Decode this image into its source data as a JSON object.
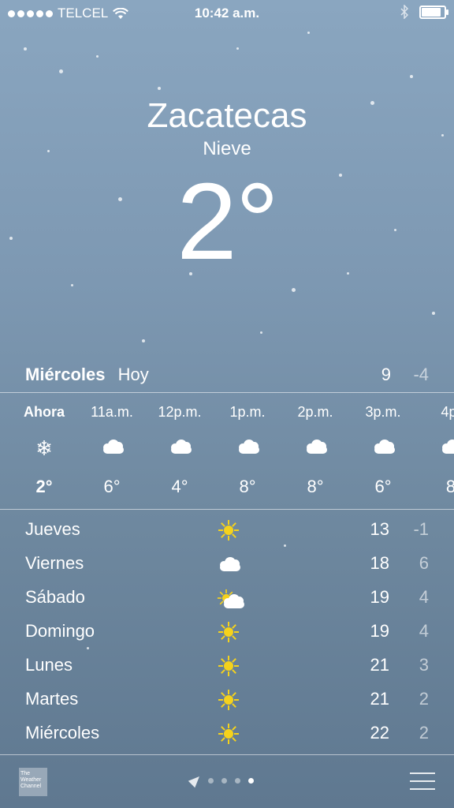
{
  "status_bar": {
    "carrier": "TELCEL",
    "time": "10:42 a.m."
  },
  "location": {
    "city": "Zacatecas",
    "condition": "Nieve",
    "temperature": "2°"
  },
  "today": {
    "day": "Miércoles",
    "label": "Hoy",
    "high": "9",
    "low": "-4"
  },
  "hourly": [
    {
      "time": "Ahora",
      "icon": "snowflake-icon",
      "temp": "2°"
    },
    {
      "time": "11a.m.",
      "icon": "cloud-icon",
      "temp": "6°"
    },
    {
      "time": "12p.m.",
      "icon": "cloud-icon",
      "temp": "4°"
    },
    {
      "time": "1p.m.",
      "icon": "cloud-icon",
      "temp": "8°"
    },
    {
      "time": "2p.m.",
      "icon": "cloud-icon",
      "temp": "8°"
    },
    {
      "time": "3p.m.",
      "icon": "cloud-icon",
      "temp": "6°"
    },
    {
      "time": "4p.",
      "icon": "cloud-icon",
      "temp": "8"
    }
  ],
  "daily": [
    {
      "day": "Jueves",
      "icon": "sun-icon",
      "high": "13",
      "low": "-1"
    },
    {
      "day": "Viernes",
      "icon": "cloud-icon",
      "high": "18",
      "low": "6"
    },
    {
      "day": "Sábado",
      "icon": "partly-sunny-icon",
      "high": "19",
      "low": "4"
    },
    {
      "day": "Domingo",
      "icon": "sun-icon",
      "high": "19",
      "low": "4"
    },
    {
      "day": "Lunes",
      "icon": "sun-icon",
      "high": "21",
      "low": "3"
    },
    {
      "day": "Martes",
      "icon": "sun-icon",
      "high": "21",
      "low": "2"
    },
    {
      "day": "Miércoles",
      "icon": "sun-icon",
      "high": "22",
      "low": "2"
    }
  ],
  "footer": {
    "logo_text": "The Weather Channel",
    "page_count": 4,
    "active_page": 4
  },
  "colors": {
    "sun": "#f5d21c"
  }
}
